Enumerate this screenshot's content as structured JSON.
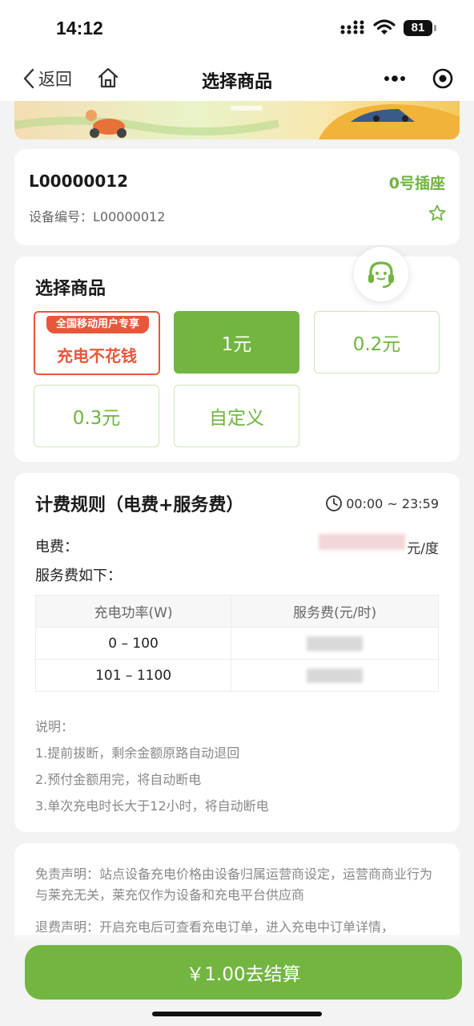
{
  "status_bar": {
    "time": "14:12",
    "battery": "81"
  },
  "nav": {
    "back_label": "返回",
    "title": "选择商品"
  },
  "device": {
    "id": "L00000012",
    "socket": "0号插座",
    "number_label": "设备编号：",
    "number_value": "L00000012"
  },
  "products": {
    "title": "选择商品",
    "promo_tag": "全国移动用户专享",
    "promo_main": "充电不花钱",
    "options": [
      "1元",
      "0.2元",
      "0.3元",
      "自定义"
    ],
    "selected": "1元"
  },
  "fees": {
    "title": "计费规则（电费+服务费）",
    "time_range": "00:00 ~ 23:59",
    "electricity_label": "电费：",
    "electricity_unit": "元/度",
    "service_label": "服务费如下：",
    "table_headers": [
      "充电功率(W)",
      "服务费(元/时)"
    ],
    "table_rows": [
      [
        "0 – 100",
        ""
      ],
      [
        "101 – 1100",
        ""
      ]
    ],
    "notes_title": "说明：",
    "notes": [
      "1.提前拔断，剩余金额原路自动退回",
      "2.预付金额用完，将自动断电",
      "3.单次充电时长大于12小时，将自动断电"
    ]
  },
  "disclaimer": {
    "free": "免责声明：站点设备充电价格由设备归属运营商设定，运营商商业行为与莱充无关，莱充仅作为设备和充电平台供应商",
    "refund": "退费声明：开启充电后可查看充电订单，进入充电中订单详情，"
  },
  "checkout": {
    "label": "￥1.00去结算"
  },
  "colors": {
    "accent": "#72b540",
    "promo": "#e8573a"
  }
}
